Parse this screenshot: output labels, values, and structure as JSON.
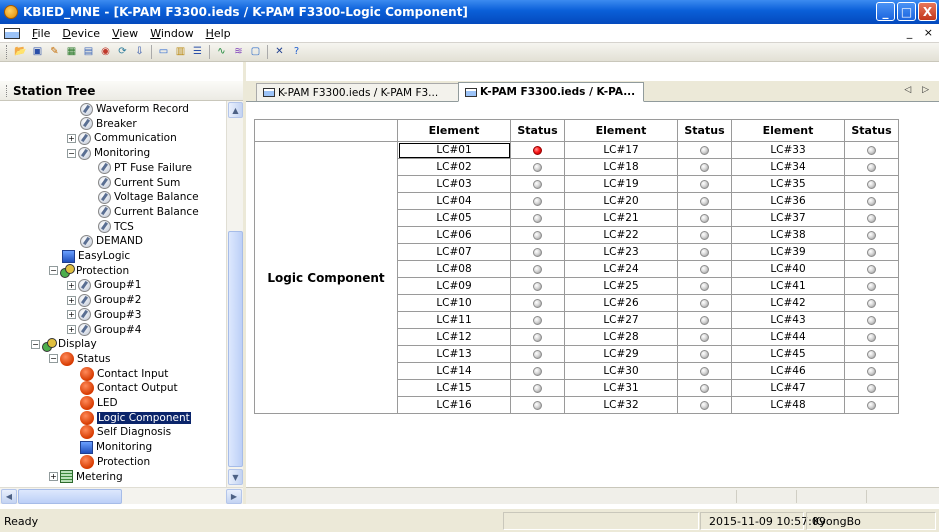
{
  "window": {
    "title": "KBIED_MNE - [K-PAM F3300.ieds / K-PAM F3300-Logic Component]",
    "min_glyph": "_",
    "max_glyph": "□",
    "close_glyph": "X",
    "mdi_controls": "_ ×"
  },
  "menu": {
    "items": [
      {
        "key": "F",
        "rest": "ile"
      },
      {
        "key": "D",
        "rest": "evice"
      },
      {
        "key": "V",
        "rest": "iew"
      },
      {
        "key": "W",
        "rest": "indow"
      },
      {
        "key": "H",
        "rest": "elp"
      }
    ]
  },
  "toolbar": {
    "buttons": [
      {
        "icon": "open-folder-icon",
        "glyph": "📂",
        "color": "#d49a1a"
      },
      {
        "icon": "save-icon",
        "glyph": "▣",
        "color": "#2a4fa8"
      },
      {
        "icon": "edit-icon",
        "glyph": "✎",
        "color": "#c46b00"
      },
      {
        "icon": "device-icon",
        "glyph": "▦",
        "color": "#2a7a2a"
      },
      {
        "icon": "settings-icon",
        "glyph": "▤",
        "color": "#3a65b8"
      },
      {
        "icon": "connect-icon",
        "glyph": "◉",
        "color": "#c0392b"
      },
      {
        "icon": "refresh-icon",
        "glyph": "⟳",
        "color": "#2a7a9a"
      },
      {
        "icon": "download-icon",
        "glyph": "⇩",
        "color": "#2a4fa8"
      },
      {
        "icon": "monitor-icon",
        "glyph": "▭",
        "color": "#1f5fd0"
      },
      {
        "icon": "grid-icon",
        "glyph": "▥",
        "color": "#b8860b"
      },
      {
        "icon": "list-icon",
        "glyph": "☰",
        "color": "#2a4fa8"
      },
      {
        "icon": "wave-icon",
        "glyph": "∿",
        "color": "#1f8a3a"
      },
      {
        "icon": "waveform-icon",
        "glyph": "≋",
        "color": "#7a3ab8"
      },
      {
        "icon": "window-icon",
        "glyph": "▢",
        "color": "#2a6ac8"
      },
      {
        "icon": "close-x-icon",
        "glyph": "✕",
        "color": "#1f3f8f"
      },
      {
        "icon": "help-icon",
        "glyph": "?",
        "color": "#1f5fd0"
      }
    ]
  },
  "station_tree": {
    "title": "Station Tree",
    "items": [
      {
        "label": "Waveform Record",
        "icon": "doc-icon",
        "depth": 3,
        "expander": ""
      },
      {
        "label": "Breaker",
        "icon": "doc-icon",
        "depth": 3,
        "expander": ""
      },
      {
        "label": "Communication",
        "icon": "doc-icon",
        "depth": 3,
        "expander": "+"
      },
      {
        "label": "Monitoring",
        "icon": "doc-icon",
        "depth": 3,
        "expander": "−"
      },
      {
        "label": "PT Fuse Failure",
        "icon": "doc-icon",
        "depth": 4,
        "expander": ""
      },
      {
        "label": "Current Sum",
        "icon": "doc-icon",
        "depth": 4,
        "expander": ""
      },
      {
        "label": "Voltage Balance",
        "icon": "doc-icon",
        "depth": 4,
        "expander": ""
      },
      {
        "label": "Current Balance",
        "icon": "doc-icon",
        "depth": 4,
        "expander": ""
      },
      {
        "label": "TCS",
        "icon": "doc-icon",
        "depth": 4,
        "expander": ""
      },
      {
        "label": "DEMAND",
        "icon": "doc-icon",
        "depth": 3,
        "expander": ""
      },
      {
        "label": "EasyLogic",
        "icon": "monitor-icon",
        "depth": 2,
        "expander": ""
      },
      {
        "label": "Protection",
        "icon": "protection-icon",
        "depth": 2,
        "expander": "−"
      },
      {
        "label": "Group#1",
        "icon": "doc-icon",
        "depth": 3,
        "expander": "+"
      },
      {
        "label": "Group#2",
        "icon": "doc-icon",
        "depth": 3,
        "expander": "+"
      },
      {
        "label": "Group#3",
        "icon": "doc-icon",
        "depth": 3,
        "expander": "+"
      },
      {
        "label": "Group#4",
        "icon": "doc-icon",
        "depth": 3,
        "expander": "+"
      },
      {
        "label": "Display",
        "icon": "protection-icon",
        "depth": 1,
        "expander": "−"
      },
      {
        "label": "Status",
        "icon": "red-circle-icon",
        "depth": 2,
        "expander": "−"
      },
      {
        "label": "Contact Input",
        "icon": "red-circle-icon",
        "depth": 3,
        "expander": ""
      },
      {
        "label": "Contact Output",
        "icon": "red-circle-icon",
        "depth": 3,
        "expander": ""
      },
      {
        "label": "LED",
        "icon": "red-circle-icon",
        "depth": 3,
        "expander": ""
      },
      {
        "label": "Logic Component",
        "icon": "red-circle-icon",
        "depth": 3,
        "expander": "",
        "selected": true
      },
      {
        "label": "Self Diagnosis",
        "icon": "red-circle-icon",
        "depth": 3,
        "expander": ""
      },
      {
        "label": "Monitoring",
        "icon": "monitor-icon",
        "depth": 3,
        "expander": ""
      },
      {
        "label": "Protection",
        "icon": "red-circle-icon",
        "depth": 3,
        "expander": ""
      },
      {
        "label": "Metering",
        "icon": "grid-icon",
        "depth": 2,
        "expander": "+"
      }
    ]
  },
  "tabs": [
    {
      "label": "K-PAM F3300.ieds / K-PAM F3...",
      "active": false
    },
    {
      "label": "K-PAM F3300.ieds / K-PA...",
      "active": true
    }
  ],
  "tab_scroll": "◁ ▷",
  "logic_table": {
    "row_header": "Logic Component",
    "headers": [
      "Element",
      "Status",
      "Element",
      "Status",
      "Element",
      "Status"
    ],
    "rows": [
      [
        {
          "el": "LC#01",
          "on": true
        },
        {
          "el": "LC#17",
          "on": false
        },
        {
          "el": "LC#33",
          "on": false
        }
      ],
      [
        {
          "el": "LC#02",
          "on": false
        },
        {
          "el": "LC#18",
          "on": false
        },
        {
          "el": "LC#34",
          "on": false
        }
      ],
      [
        {
          "el": "LC#03",
          "on": false
        },
        {
          "el": "LC#19",
          "on": false
        },
        {
          "el": "LC#35",
          "on": false
        }
      ],
      [
        {
          "el": "LC#04",
          "on": false
        },
        {
          "el": "LC#20",
          "on": false
        },
        {
          "el": "LC#36",
          "on": false
        }
      ],
      [
        {
          "el": "LC#05",
          "on": false
        },
        {
          "el": "LC#21",
          "on": false
        },
        {
          "el": "LC#37",
          "on": false
        }
      ],
      [
        {
          "el": "LC#06",
          "on": false
        },
        {
          "el": "LC#22",
          "on": false
        },
        {
          "el": "LC#38",
          "on": false
        }
      ],
      [
        {
          "el": "LC#07",
          "on": false
        },
        {
          "el": "LC#23",
          "on": false
        },
        {
          "el": "LC#39",
          "on": false
        }
      ],
      [
        {
          "el": "LC#08",
          "on": false
        },
        {
          "el": "LC#24",
          "on": false
        },
        {
          "el": "LC#40",
          "on": false
        }
      ],
      [
        {
          "el": "LC#09",
          "on": false
        },
        {
          "el": "LC#25",
          "on": false
        },
        {
          "el": "LC#41",
          "on": false
        }
      ],
      [
        {
          "el": "LC#10",
          "on": false
        },
        {
          "el": "LC#26",
          "on": false
        },
        {
          "el": "LC#42",
          "on": false
        }
      ],
      [
        {
          "el": "LC#11",
          "on": false
        },
        {
          "el": "LC#27",
          "on": false
        },
        {
          "el": "LC#43",
          "on": false
        }
      ],
      [
        {
          "el": "LC#12",
          "on": false
        },
        {
          "el": "LC#28",
          "on": false
        },
        {
          "el": "LC#44",
          "on": false
        }
      ],
      [
        {
          "el": "LC#13",
          "on": false
        },
        {
          "el": "LC#29",
          "on": false
        },
        {
          "el": "LC#45",
          "on": false
        }
      ],
      [
        {
          "el": "LC#14",
          "on": false
        },
        {
          "el": "LC#30",
          "on": false
        },
        {
          "el": "LC#46",
          "on": false
        }
      ],
      [
        {
          "el": "LC#15",
          "on": false
        },
        {
          "el": "LC#31",
          "on": false
        },
        {
          "el": "LC#47",
          "on": false
        }
      ],
      [
        {
          "el": "LC#16",
          "on": false
        },
        {
          "el": "LC#32",
          "on": false
        },
        {
          "el": "LC#48",
          "on": false
        }
      ]
    ]
  },
  "colors": {
    "status_on": "#ff1a1a",
    "status_off": "#d8d8d8",
    "selection": "#0a246a",
    "titlebar": "#0a5fd8"
  },
  "statusbar": {
    "ready": "Ready",
    "datetime": "2015-11-09 10:57:09",
    "user": "KyongBo"
  }
}
